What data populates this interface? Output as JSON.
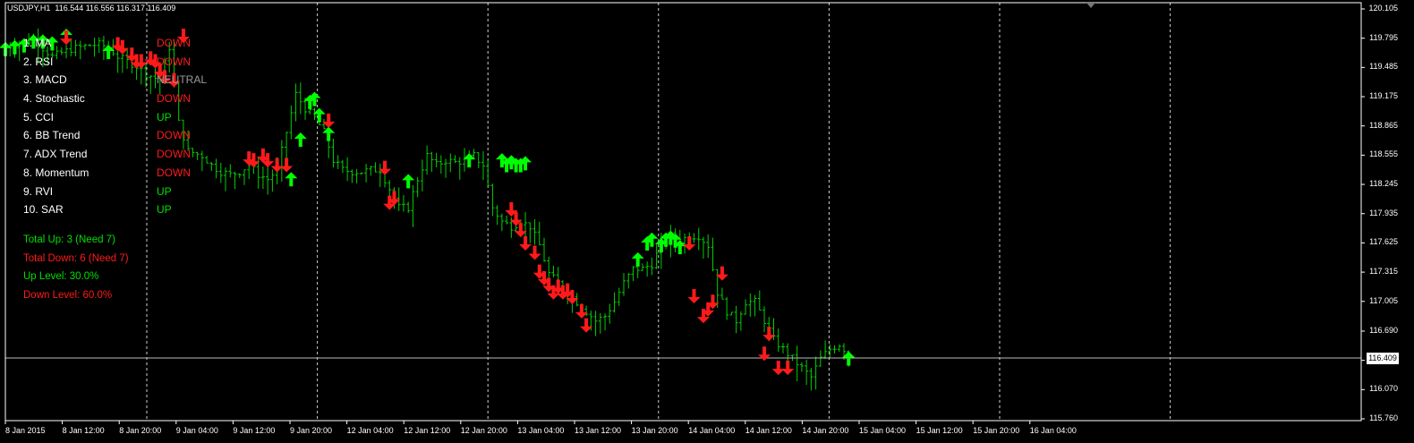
{
  "window": {
    "title": "USDJPY,H1  116.544 116.556 116.317 116.409",
    "symbol": "USDJPY",
    "timeframe": "H1",
    "ohlc": [
      "116.544",
      "116.556",
      "116.317",
      "116.409"
    ]
  },
  "colors": {
    "background": "#000000",
    "bar": "#00d000",
    "up": "#00ff00",
    "down": "#ff1a1a",
    "neutral": "#9a9a9a",
    "grid": "#ffffff",
    "axis": "#ffffff"
  },
  "indicators": [
    {
      "name": "1. MA",
      "status": "DOWN",
      "color": "#ff1a1a"
    },
    {
      "name": "2. RSI",
      "status": "DOWN",
      "color": "#ff1a1a"
    },
    {
      "name": "3. MACD",
      "status": "NEUTRAL",
      "color": "#9a9a9a"
    },
    {
      "name": "4. Stochastic",
      "status": "DOWN",
      "color": "#ff1a1a"
    },
    {
      "name": "5. CCI",
      "status": "UP",
      "color": "#00e000"
    },
    {
      "name": "6. BB Trend",
      "status": "DOWN",
      "color": "#ff1a1a"
    },
    {
      "name": "7. ADX Trend",
      "status": "DOWN",
      "color": "#ff1a1a"
    },
    {
      "name": "8. Momentum",
      "status": "DOWN",
      "color": "#ff1a1a"
    },
    {
      "name": "9. RVI",
      "status": "UP",
      "color": "#00e000"
    },
    {
      "name": "10. SAR",
      "status": "UP",
      "color": "#00e000"
    }
  ],
  "totals": {
    "up": "Total Up: 3 (Need 7)",
    "down": "Total Down: 6 (Need 7)",
    "up_level": "Up Level: 30.0%",
    "down_level": "Down Level: 60.0%"
  },
  "price_axis": {
    "labels": [
      "120.105",
      "119.795",
      "119.485",
      "119.175",
      "118.865",
      "118.555",
      "118.245",
      "117.935",
      "117.625",
      "117.315",
      "117.005",
      "116.690",
      "116.380",
      "116.070",
      "115.760"
    ],
    "current": "116.409"
  },
  "time_axis": {
    "labels": [
      "8 Jan 2015",
      "8 Jan 12:00",
      "8 Jan 20:00",
      "9 Jan 04:00",
      "9 Jan 12:00",
      "9 Jan 20:00",
      "12 Jan 04:00",
      "12 Jan 12:00",
      "12 Jan 20:00",
      "13 Jan 04:00",
      "13 Jan 12:00",
      "13 Jan 20:00",
      "14 Jan 04:00",
      "14 Jan 12:00",
      "14 Jan 20:00",
      "15 Jan 04:00",
      "15 Jan 12:00",
      "15 Jan 20:00",
      "16 Jan 04:00"
    ]
  },
  "chart_data": {
    "type": "line",
    "style": "ohlc-bars",
    "ylim": [
      115.76,
      120.105
    ],
    "current_price": 116.409,
    "x_range_hours": [
      0,
      230
    ],
    "grid": "vertical-dashed",
    "close_path": [
      [
        0,
        119.7
      ],
      [
        6,
        119.78
      ],
      [
        10,
        119.6
      ],
      [
        14,
        119.68
      ],
      [
        18,
        119.72
      ],
      [
        20,
        119.73
      ],
      [
        22,
        119.7
      ],
      [
        24,
        119.6
      ],
      [
        26,
        119.55
      ],
      [
        28,
        119.5
      ],
      [
        30,
        119.42
      ],
      [
        33,
        119.35
      ],
      [
        35,
        119.7
      ],
      [
        37,
        118.9
      ],
      [
        39,
        118.6
      ],
      [
        42,
        118.55
      ],
      [
        44,
        118.45
      ],
      [
        46,
        118.38
      ],
      [
        48,
        118.35
      ],
      [
        50,
        118.38
      ],
      [
        52,
        118.45
      ],
      [
        54,
        118.35
      ],
      [
        56,
        118.3
      ],
      [
        58,
        118.4
      ],
      [
        60,
        118.8
      ],
      [
        62,
        119.2
      ],
      [
        64,
        119.05
      ],
      [
        66,
        118.95
      ],
      [
        68,
        118.8
      ],
      [
        70,
        118.5
      ],
      [
        72,
        118.4
      ],
      [
        74,
        118.38
      ],
      [
        76,
        118.38
      ],
      [
        78,
        118.4
      ],
      [
        80,
        118.4
      ],
      [
        82,
        118.2
      ],
      [
        84,
        118.0
      ],
      [
        86,
        118.0
      ],
      [
        88,
        118.3
      ],
      [
        90,
        118.55
      ],
      [
        92,
        118.45
      ],
      [
        94,
        118.5
      ],
      [
        96,
        118.48
      ],
      [
        98,
        118.5
      ],
      [
        100,
        118.55
      ],
      [
        102,
        118.45
      ],
      [
        104,
        118.0
      ],
      [
        106,
        117.85
      ],
      [
        108,
        117.8
      ],
      [
        110,
        117.85
      ],
      [
        112,
        117.8
      ],
      [
        114,
        117.6
      ],
      [
        116,
        117.3
      ],
      [
        118,
        117.2
      ],
      [
        120,
        117.1
      ],
      [
        122,
        117.0
      ],
      [
        124,
        116.9
      ],
      [
        126,
        116.8
      ],
      [
        128,
        116.85
      ],
      [
        130,
        117.0
      ],
      [
        132,
        117.2
      ],
      [
        134,
        117.35
      ],
      [
        136,
        117.35
      ],
      [
        138,
        117.4
      ],
      [
        140,
        117.6
      ],
      [
        142,
        117.7
      ],
      [
        144,
        117.65
      ],
      [
        146,
        117.7
      ],
      [
        148,
        117.7
      ],
      [
        150,
        117.6
      ],
      [
        152,
        117.1
      ],
      [
        154,
        116.9
      ],
      [
        156,
        116.8
      ],
      [
        158,
        117.0
      ],
      [
        160,
        117.0
      ],
      [
        162,
        116.8
      ],
      [
        164,
        116.6
      ],
      [
        166,
        116.5
      ],
      [
        168,
        116.4
      ],
      [
        170,
        116.3
      ],
      [
        172,
        116.2
      ],
      [
        174,
        116.4
      ],
      [
        176,
        116.5
      ],
      [
        178,
        116.55
      ],
      [
        180,
        116.45
      ]
    ],
    "signals_up": [
      [
        0,
        119.68
      ],
      [
        2,
        119.7
      ],
      [
        4,
        119.72
      ],
      [
        6,
        119.76
      ],
      [
        8,
        119.76
      ],
      [
        10,
        119.74
      ],
      [
        13,
        119.82
      ],
      [
        22,
        119.65
      ],
      [
        61,
        118.3
      ],
      [
        63,
        118.72
      ],
      [
        65,
        119.12
      ],
      [
        66,
        119.15
      ],
      [
        67,
        118.98
      ],
      [
        69,
        118.78
      ],
      [
        86,
        118.28
      ],
      [
        99,
        118.5
      ],
      [
        106,
        118.5
      ],
      [
        107,
        118.45
      ],
      [
        108,
        118.48
      ],
      [
        109,
        118.45
      ],
      [
        110,
        118.45
      ],
      [
        111,
        118.47
      ],
      [
        135,
        117.45
      ],
      [
        137,
        117.62
      ],
      [
        138,
        117.66
      ],
      [
        140,
        117.6
      ],
      [
        141,
        117.66
      ],
      [
        142,
        117.68
      ],
      [
        143,
        117.65
      ],
      [
        144,
        117.58
      ],
      [
        180,
        116.4
      ]
    ],
    "signals_down": [
      [
        13,
        119.8
      ],
      [
        24,
        119.73
      ],
      [
        25,
        119.7
      ],
      [
        27,
        119.62
      ],
      [
        28,
        119.55
      ],
      [
        29,
        119.55
      ],
      [
        31,
        119.58
      ],
      [
        32,
        119.55
      ],
      [
        33,
        119.45
      ],
      [
        34,
        119.38
      ],
      [
        36,
        119.35
      ],
      [
        38,
        119.82
      ],
      [
        52,
        118.52
      ],
      [
        53,
        118.5
      ],
      [
        55,
        118.55
      ],
      [
        56,
        118.5
      ],
      [
        58,
        118.45
      ],
      [
        60,
        118.45
      ],
      [
        69,
        118.92
      ],
      [
        81,
        118.42
      ],
      [
        82,
        118.05
      ],
      [
        83,
        118.1
      ],
      [
        108,
        117.98
      ],
      [
        109,
        117.88
      ],
      [
        110,
        117.76
      ],
      [
        111,
        117.62
      ],
      [
        113,
        117.52
      ],
      [
        114,
        117.32
      ],
      [
        115,
        117.25
      ],
      [
        116,
        117.18
      ],
      [
        117,
        117.1
      ],
      [
        118,
        117.16
      ],
      [
        119,
        117.1
      ],
      [
        120,
        117.12
      ],
      [
        121,
        117.05
      ],
      [
        123,
        116.9
      ],
      [
        124,
        116.75
      ],
      [
        146,
        117.62
      ],
      [
        147,
        117.06
      ],
      [
        149,
        116.85
      ],
      [
        150,
        116.92
      ],
      [
        151,
        117.0
      ],
      [
        153,
        117.3
      ],
      [
        162,
        116.45
      ],
      [
        163,
        116.66
      ],
      [
        165,
        116.3
      ],
      [
        167,
        116.3
      ]
    ]
  }
}
